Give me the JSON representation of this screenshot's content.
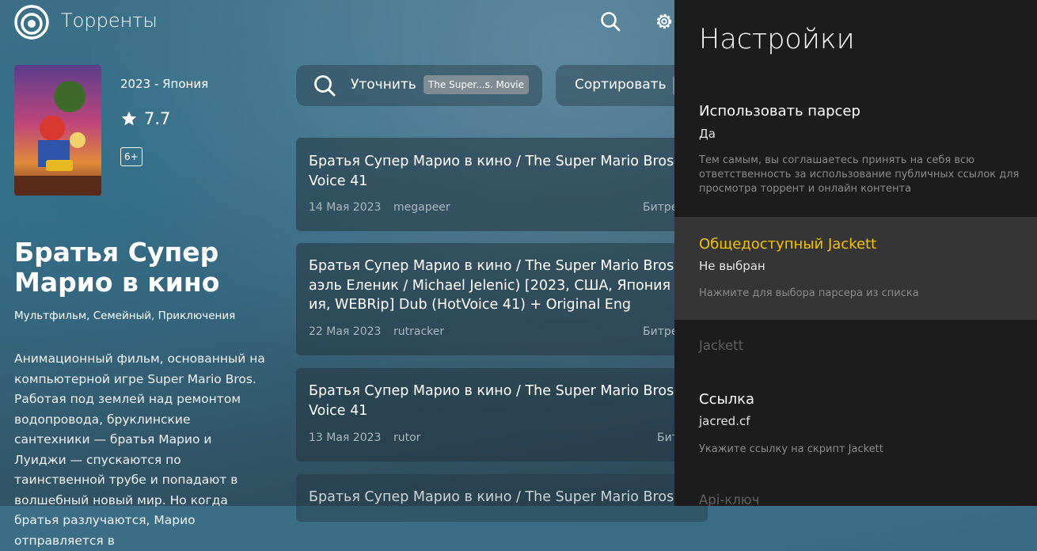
{
  "header": {
    "app_title": "Торренты",
    "icons": [
      "logo-icon",
      "search-icon",
      "gear-icon"
    ]
  },
  "movie": {
    "year_country": "2023 - Япония",
    "rating": "7.7",
    "age": "6+",
    "title": "Братья Супер Марио в кино",
    "genres": "Мультфильм, Семейный, Приключения",
    "description": "Анимационный фильм, основанный на компьютерной игре Super Mario Bros. Работая под землей над ремонтом водопровода, бруклинские сантехники — братья Марио и Луиджи — спускаются по таинственной трубе и попадают в волшебный новый мир. Но когда братья разлучаются, Марио отправляется в"
  },
  "filter": {
    "label": "Уточнить",
    "tag": "The Super...s. Movie"
  },
  "sort": {
    "label": "Сортировать"
  },
  "torrents": [
    {
      "title": "Братья Супер Марио в кино / The Super Mario Bros\nVoice 41",
      "date": "14 Мая 2023",
      "tracker": "megapeer",
      "extra": "Битре"
    },
    {
      "title": "Братья Супер Марио в кино / The Super Mario Bros\nаэль Еленик / Michael Jelenic) [2023, США, Япония\nия, WEBRip] Dub (HotVoice 41) + Original Eng",
      "date": "22 Мая 2023",
      "tracker": "rutracker",
      "extra": "Битре"
    },
    {
      "title": "Братья Супер Марио в кино / The Super Mario Bros\nVoice 41",
      "date": "13 Мая 2023",
      "tracker": "rutor",
      "extra": "Бит"
    },
    {
      "title": "Братья Супер Марио в кино / The Super Mario Bros",
      "date": "",
      "tracker": "",
      "extra": ""
    }
  ],
  "settings": {
    "title": "Настройки",
    "items": [
      {
        "name": "Использовать парсер",
        "value": "Да",
        "desc": "Тем самым, вы соглашаетесь принять на себя всю ответственность за использование публичных ссылок для просмотра торрент и онлайн контента"
      },
      {
        "name": "Общедоступный Jackett",
        "value": "Не выбран",
        "desc": "Нажмите для выбора парсера из списка"
      },
      {
        "name": "Jackett"
      },
      {
        "name": "Ссылка",
        "value": "jacred.cf",
        "desc": "Укажите ссылку на скрипт Jackett"
      },
      {
        "name": "Api-ключ"
      }
    ]
  },
  "colors": {
    "accent": "#f3c400",
    "panel_bg": "#1c1c1c",
    "focused_bg": "#353535"
  }
}
